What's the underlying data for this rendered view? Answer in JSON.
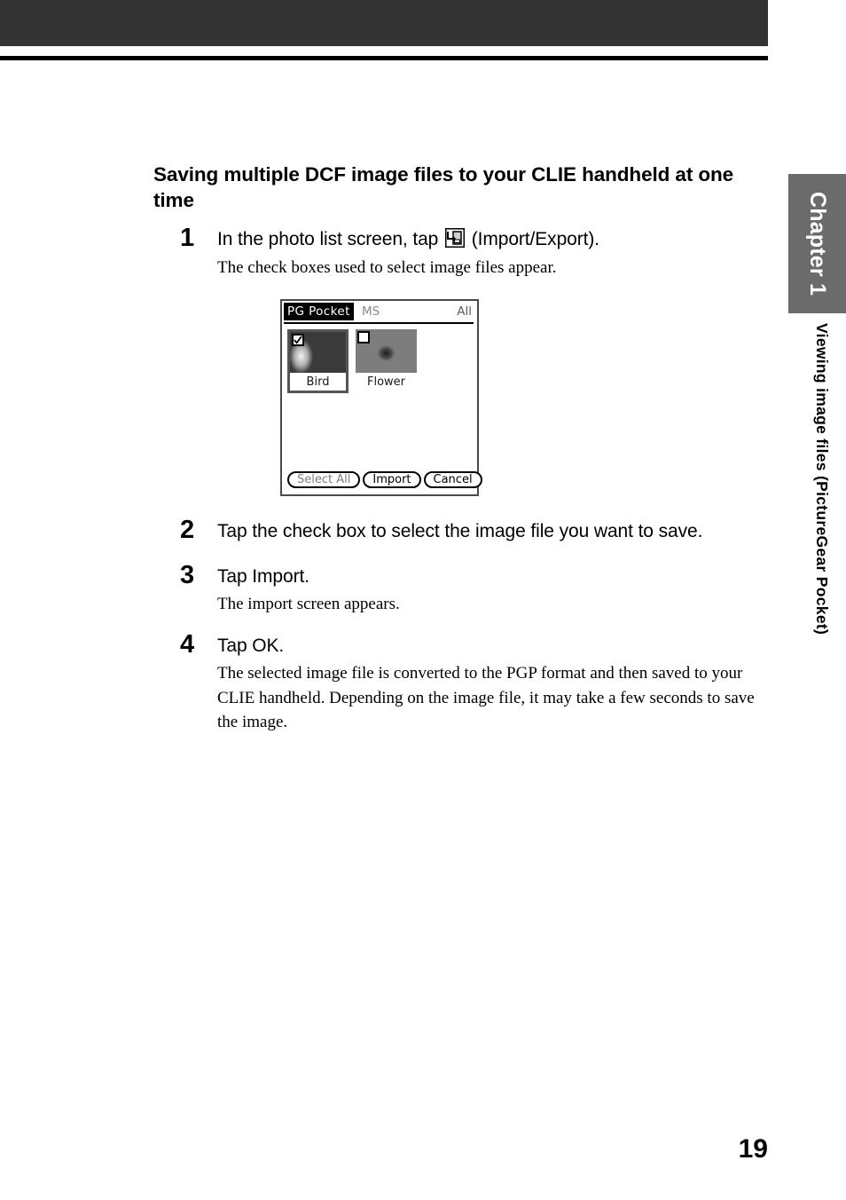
{
  "header": {
    "bar_color": "#333333",
    "rule_color": "#000000"
  },
  "sidebar": {
    "chapter_tab": "Chapter 1",
    "chapter_tab_bg": "#6b6b6b",
    "running_head": "Viewing image files  (PictureGear Pocket)"
  },
  "content": {
    "section_heading": "Saving multiple DCF image files to your CLIE handheld at one time",
    "steps": [
      {
        "number": "1",
        "title_before_icon": "In the photo list screen, tap ",
        "icon": "import-export-icon",
        "title_after_icon": " (Import/Export).",
        "body": "The check boxes used to select image files appear."
      },
      {
        "number": "2",
        "title": "Tap the check box to select the image file you want to save.",
        "body": ""
      },
      {
        "number": "3",
        "title": "Tap Import.",
        "body": "The import screen appears."
      },
      {
        "number": "4",
        "title": "Tap OK.",
        "body": "The selected image file is converted to the PGP format and then saved to your CLIE handheld. Depending on the image file, it may take a few seconds to save the image."
      }
    ]
  },
  "pda_screenshot": {
    "app_tab": "PG Pocket",
    "source": "MS",
    "filter": "All",
    "thumbnails": [
      {
        "label": "Bird",
        "checked": true,
        "selected": true
      },
      {
        "label": "Flower",
        "checked": false,
        "selected": false
      }
    ],
    "buttons": [
      {
        "label": "Select All",
        "state": "dim"
      },
      {
        "label": "Import",
        "state": "normal"
      },
      {
        "label": "Cancel",
        "state": "normal"
      }
    ]
  },
  "footer": {
    "page_number": "19"
  }
}
